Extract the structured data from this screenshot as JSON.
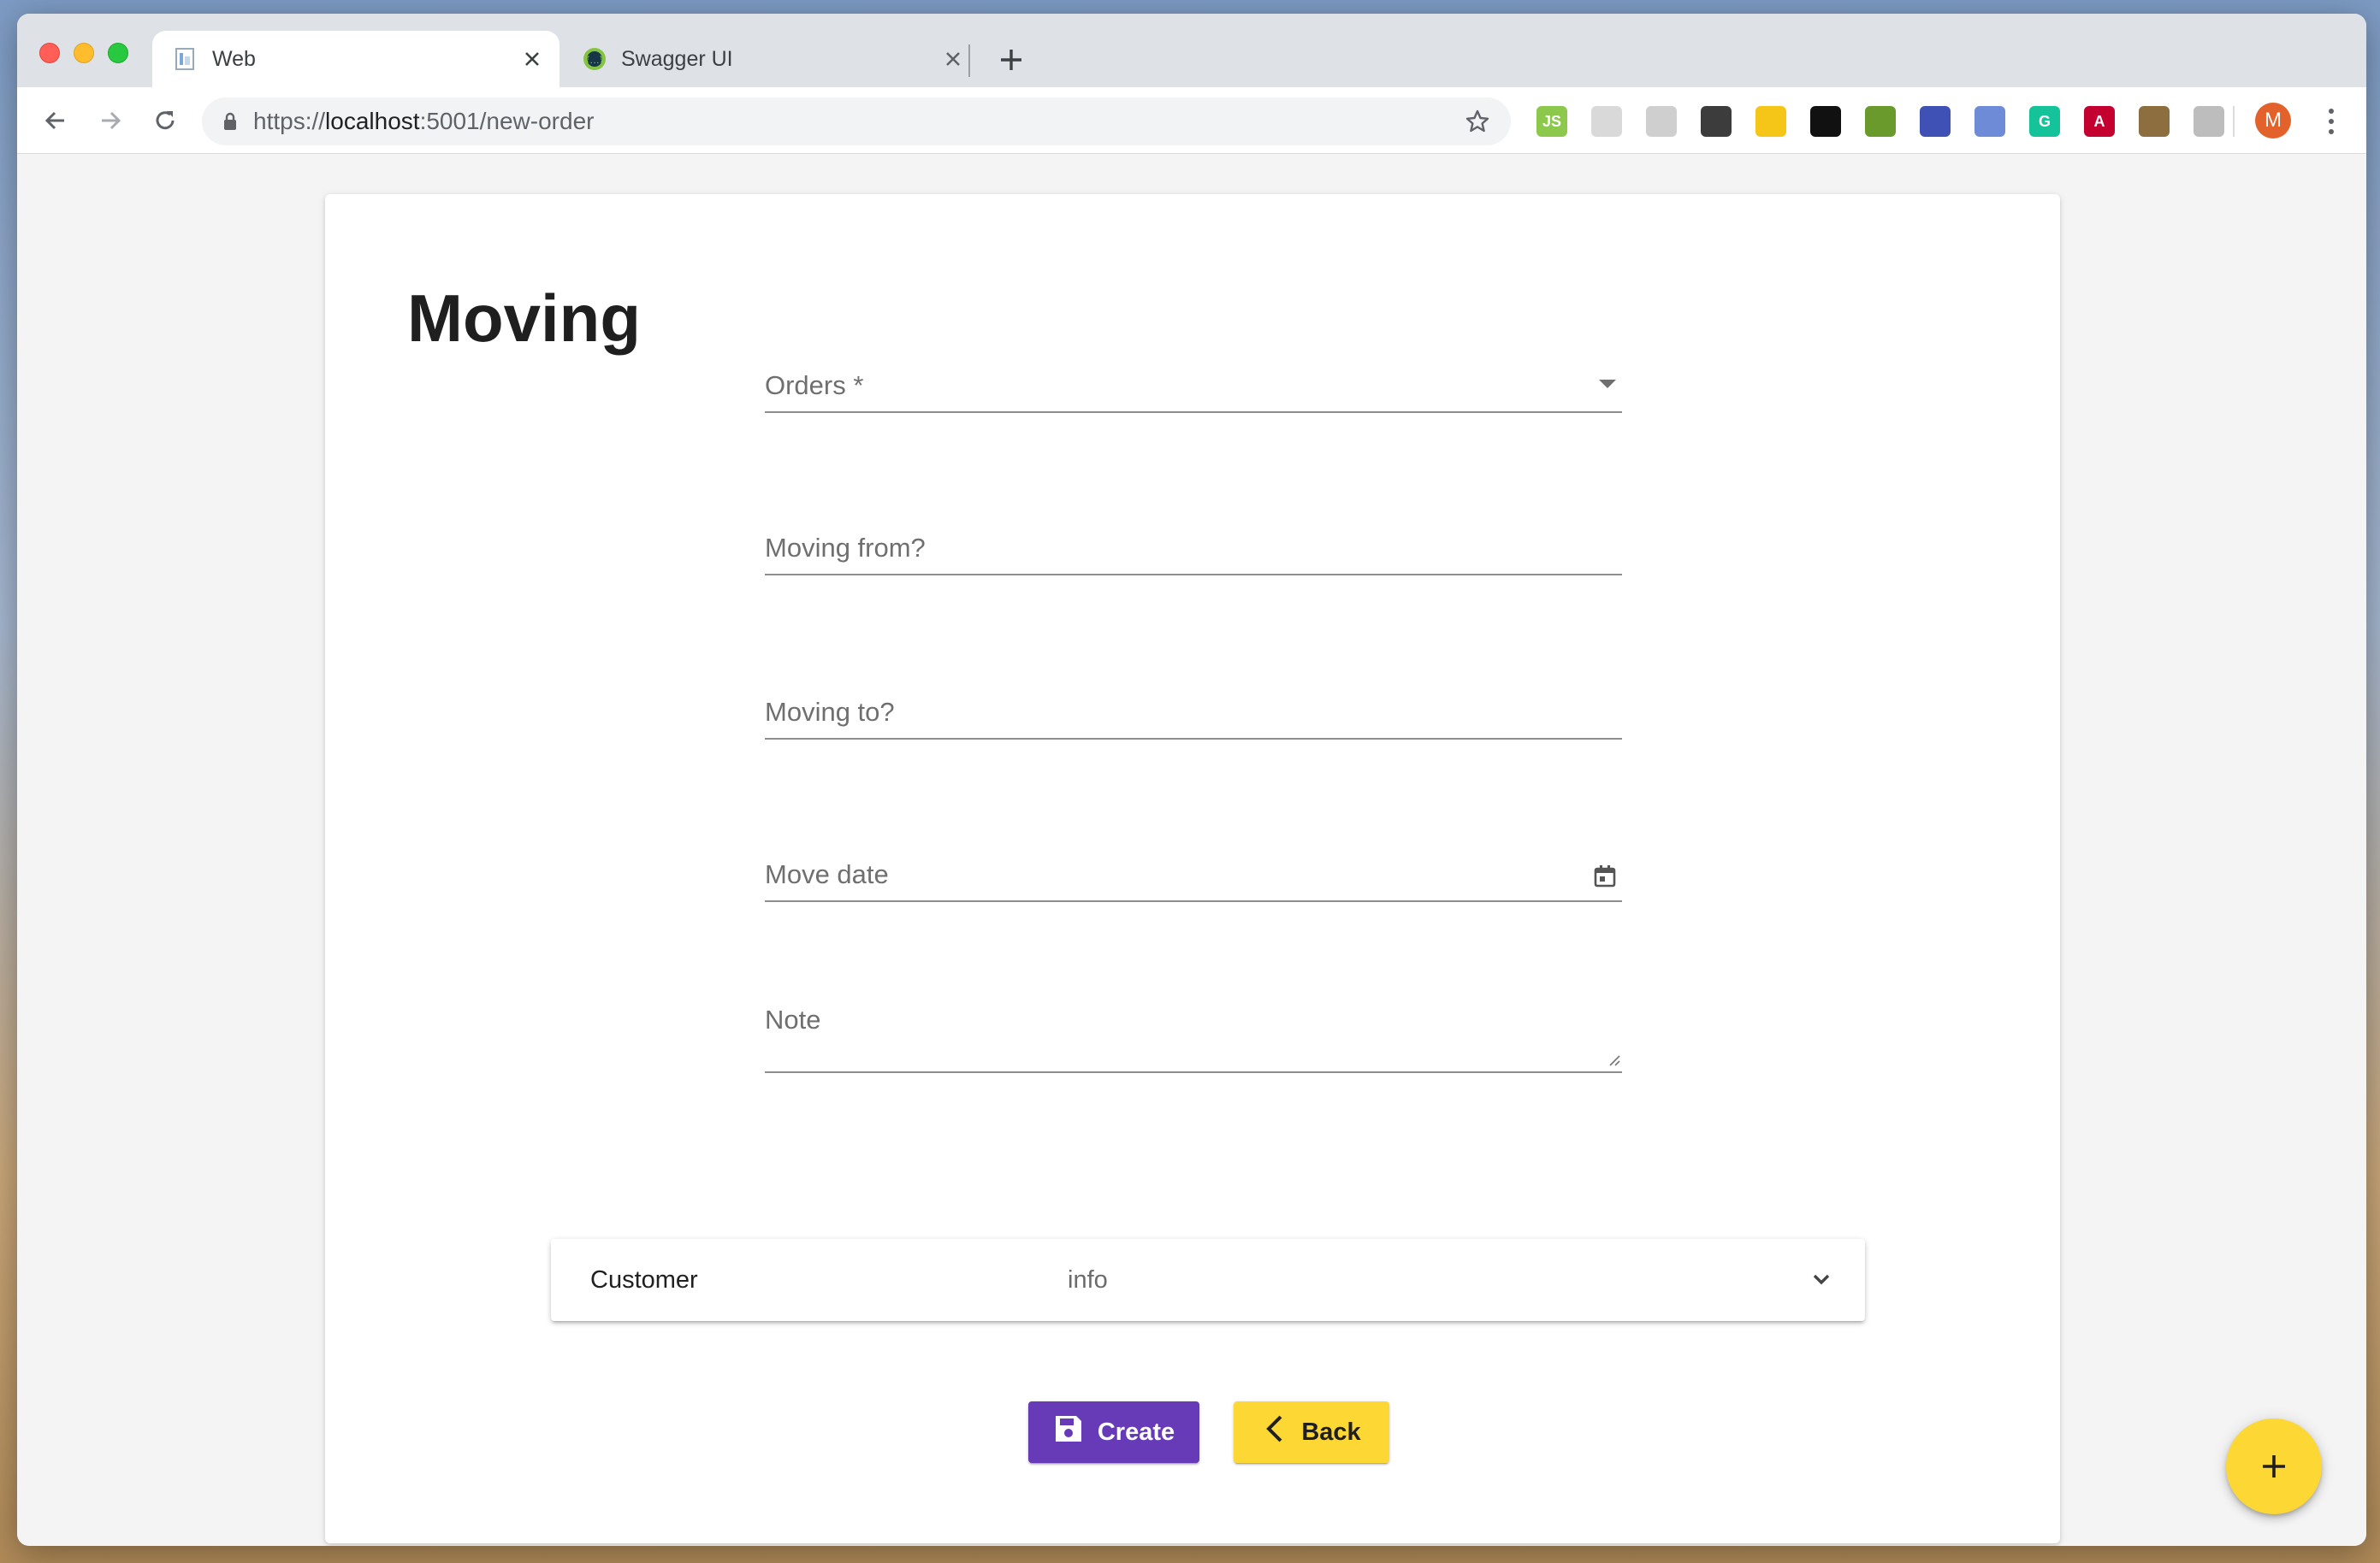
{
  "browser": {
    "tabs": [
      {
        "title": "Web",
        "favicon": "web-app-icon"
      },
      {
        "title": "Swagger UI",
        "favicon": "swagger-icon"
      }
    ],
    "url": {
      "scheme": "https://",
      "host": "localhost",
      "rest": ":5001/new-order"
    },
    "extensions": [
      {
        "icon": "nodejs-extension-icon",
        "label": "JS",
        "color": "#8cc84b"
      },
      {
        "icon": "generic-extension-icon",
        "label": "",
        "color": "#d9d9d9"
      },
      {
        "icon": "timer-extension-icon",
        "label": "",
        "color": "#cfcfcf"
      },
      {
        "icon": "bracket-extension-icon",
        "label": "",
        "color": "#3c3c3c"
      },
      {
        "icon": "moon-extension-icon",
        "label": "",
        "color": "#f5c518"
      },
      {
        "icon": "sparkle-extension-icon",
        "label": "",
        "color": "#111111"
      },
      {
        "icon": "swagger-extension-icon",
        "label": "",
        "color": "#6a9a2b"
      },
      {
        "icon": "lighthouse-extension-icon",
        "label": "",
        "color": "#3f51b5"
      },
      {
        "icon": "disc-extension-icon",
        "label": "",
        "color": "#6d8bd6"
      },
      {
        "icon": "grammarly-extension-icon",
        "label": "G",
        "color": "#15c39a"
      },
      {
        "icon": "angular-extension-icon",
        "label": "A",
        "color": "#c3002f"
      },
      {
        "icon": "books-extension-icon",
        "label": "",
        "color": "#8d6e3f"
      },
      {
        "icon": "tree-extension-icon",
        "label": "",
        "color": "#bdbdbd"
      }
    ],
    "avatar_initial": "M"
  },
  "page": {
    "title": "Moving",
    "fields": {
      "orders": {
        "label": "Orders *"
      },
      "moving_from": {
        "label": "Moving from?"
      },
      "moving_to": {
        "label": "Moving to?"
      },
      "move_date": {
        "label": "Move date"
      },
      "note": {
        "label": "Note"
      }
    },
    "customer_panel": {
      "title": "Customer",
      "description": "info"
    },
    "actions": {
      "create_label": "Create",
      "back_label": "Back"
    }
  },
  "colors": {
    "primary": "#673ab7",
    "accent": "#fdd835"
  }
}
